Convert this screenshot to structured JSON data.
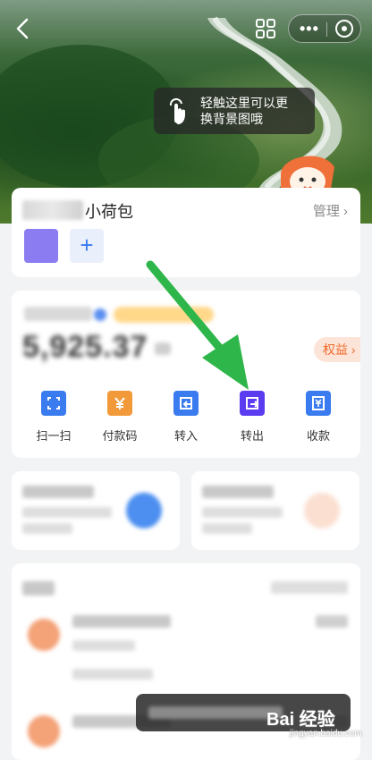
{
  "tip": {
    "line1": "轻触这里可以更",
    "line2": "换背景图哦"
  },
  "wallet": {
    "title": "小荷包",
    "manage": "管理 ",
    "add": "+"
  },
  "balance": {
    "amount": "5,925.37",
    "quanyi": "权益 "
  },
  "actions": [
    {
      "label": "扫一扫",
      "color": "#3a7bf0"
    },
    {
      "label": "付款码",
      "color": "#f29a3a"
    },
    {
      "label": "转入",
      "color": "#3a7bf0"
    },
    {
      "label": "转出",
      "color": "#5b3cf0"
    },
    {
      "label": "收款",
      "color": "#3a7bf0"
    }
  ],
  "watermark": {
    "brand": "Bai 经验",
    "url": "jingyan.baidu.com"
  },
  "colors": {
    "arrow": "#2fb64a",
    "wallet_swatch": "#8b7cf2"
  }
}
